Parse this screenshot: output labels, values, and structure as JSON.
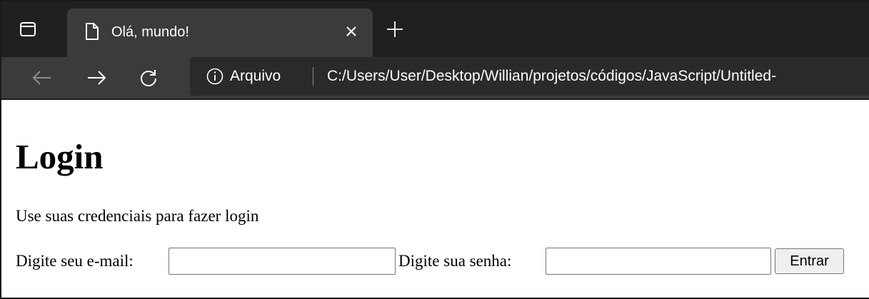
{
  "browser": {
    "tab": {
      "title": "Olá, mundo!",
      "close_glyph": "×",
      "favicon": "page-icon"
    },
    "new_tab_glyph": "+",
    "toolbar": {
      "back_icon": "back-arrow-icon",
      "forward_icon": "forward-arrow-icon",
      "reload_icon": "reload-icon"
    },
    "address_bar": {
      "security_icon": "info-icon",
      "security_label": "Arquivo",
      "url": "C:/Users/User/Desktop/Willian/projetos/códigos/JavaScript/Untitled-"
    },
    "colors": {
      "tabstrip_bg": "#202020",
      "toolbar_bg": "#3b3b3b",
      "address_bg": "#2a2a2a"
    }
  },
  "page": {
    "heading": "Login",
    "subtitle": "Use suas credenciais para fazer login",
    "form": {
      "email_label": "Digite seu e-mail:",
      "email_value": "",
      "password_label": "Digite sua senha:",
      "password_value": "",
      "submit_label": "Entrar"
    }
  }
}
